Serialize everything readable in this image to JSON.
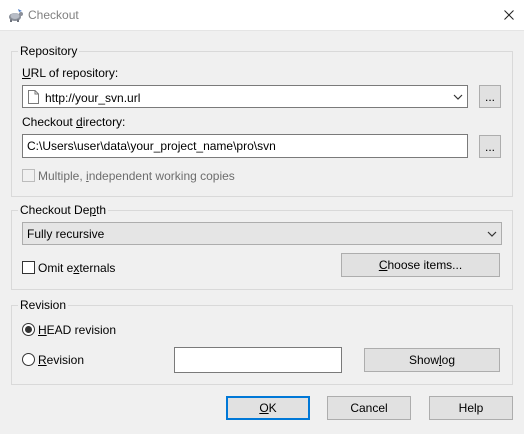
{
  "window": {
    "title": "Checkout"
  },
  "repository": {
    "legend": "Repository",
    "url_label_accel": "U",
    "url_label_rest": "RL of repository:",
    "url_value": "http://your_svn.url",
    "url_browse_label": "...",
    "dir_label_pre": "Checkout ",
    "dir_label_accel": "d",
    "dir_label_rest": "irectory:",
    "dir_value": "C:\\Users\\user\\data\\your_project_name\\pro\\svn",
    "dir_browse_label": "...",
    "multiple_pre": "Multiple, ",
    "multiple_accel": "i",
    "multiple_rest": "ndependent working copies",
    "multiple_checked": false
  },
  "depth": {
    "legend_pre": "Checkout De",
    "legend_accel": "p",
    "legend_rest": "th",
    "selected": "Fully recursive",
    "omit_pre": "Omit e",
    "omit_accel": "x",
    "omit_rest": "ternals",
    "omit_checked": false,
    "choose_accel": "C",
    "choose_rest": "hoose items..."
  },
  "revision": {
    "legend": "Revision",
    "head_accel": "H",
    "head_rest": "EAD revision",
    "head_selected": true,
    "rev_accel": "R",
    "rev_rest": "evision",
    "rev_value": "",
    "showlog_pre": "Show ",
    "showlog_accel": "l",
    "showlog_rest": "og"
  },
  "buttons": {
    "ok_accel": "O",
    "ok_rest": "K",
    "cancel": "Cancel",
    "help": "Help"
  }
}
